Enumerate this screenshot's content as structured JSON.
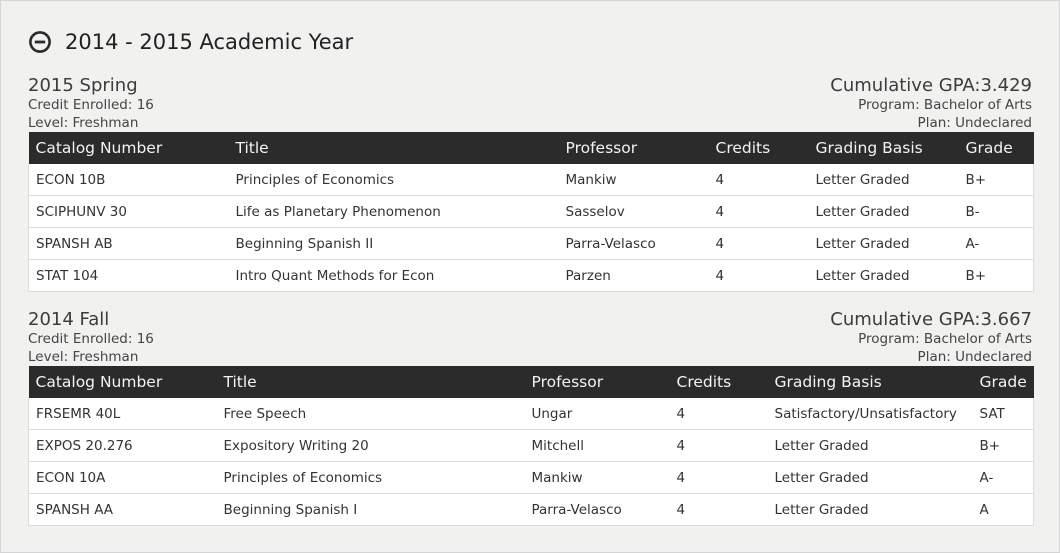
{
  "academic_year": {
    "title": "2014 - 2015 Academic Year",
    "collapse_icon": "minus-circle-icon"
  },
  "columns": {
    "catalog_number": "Catalog Number",
    "title": "Title",
    "professor": "Professor",
    "credits": "Credits",
    "grading_basis": "Grading Basis",
    "grade": "Grade"
  },
  "terms": [
    {
      "name": "2015 Spring",
      "credit_enrolled": "Credit Enrolled: 16",
      "level": "Level: Freshman",
      "gpa": "Cumulative GPA:3.429",
      "program": "Program: Bachelor of Arts",
      "plan": "Plan: Undeclared",
      "courses": [
        {
          "catalog": "ECON 10B",
          "title": "Principles of Economics",
          "professor": "Mankiw",
          "credits": "4",
          "grading": "Letter Graded",
          "grade": "B+"
        },
        {
          "catalog": "SCIPHUNV 30",
          "title": "Life as Planetary Phenomenon",
          "professor": "Sasselov",
          "credits": "4",
          "grading": "Letter Graded",
          "grade": "B-"
        },
        {
          "catalog": "SPANSH AB",
          "title": "Beginning Spanish II",
          "professor": "Parra-Velasco",
          "credits": "4",
          "grading": "Letter Graded",
          "grade": "A-"
        },
        {
          "catalog": "STAT 104",
          "title": "Intro Quant Methods for Econ",
          "professor": "Parzen",
          "credits": "4",
          "grading": "Letter Graded",
          "grade": "B+"
        }
      ]
    },
    {
      "name": "2014 Fall",
      "credit_enrolled": "Credit Enrolled: 16",
      "level": "Level: Freshman",
      "gpa": "Cumulative GPA:3.667",
      "program": "Program: Bachelor of Arts",
      "plan": "Plan: Undeclared",
      "courses": [
        {
          "catalog": "FRSEMR 40L",
          "title": "Free Speech",
          "professor": "Ungar",
          "credits": "4",
          "grading": "Satisfactory/Unsatisfactory",
          "grade": "SAT"
        },
        {
          "catalog": "EXPOS 20.276",
          "title": "Expository Writing 20",
          "professor": "Mitchell",
          "credits": "4",
          "grading": "Letter Graded",
          "grade": "B+"
        },
        {
          "catalog": "ECON 10A",
          "title": "Principles of Economics",
          "professor": "Mankiw",
          "credits": "4",
          "grading": "Letter Graded",
          "grade": "A-"
        },
        {
          "catalog": "SPANSH AA",
          "title": "Beginning Spanish I",
          "professor": "Parra-Velasco",
          "credits": "4",
          "grading": "Letter Graded",
          "grade": "A"
        }
      ]
    }
  ]
}
